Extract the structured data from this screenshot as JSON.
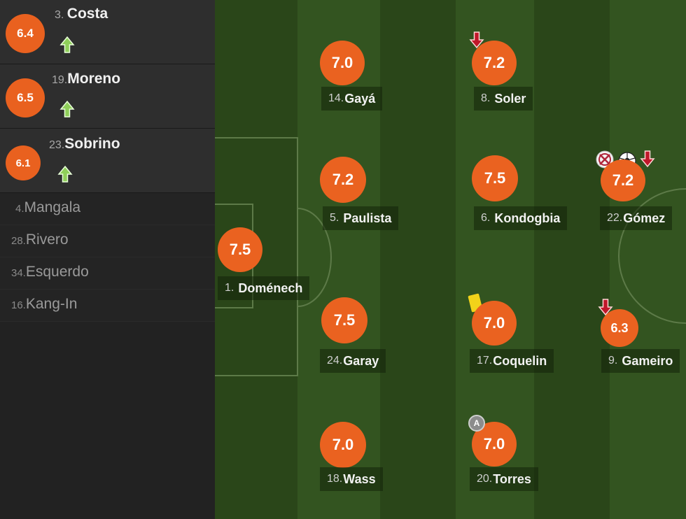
{
  "substitutes": [
    {
      "number": "3.",
      "name": "Costa",
      "rating": "6.4"
    },
    {
      "number": "19.",
      "name": "Moreno",
      "rating": "6.5"
    },
    {
      "number": "23.",
      "name": "Sobrino",
      "rating": "6.1"
    }
  ],
  "bench": [
    {
      "number": "4.",
      "name": "Mangala"
    },
    {
      "number": "28.",
      "name": "Rivero"
    },
    {
      "number": "34.",
      "name": "Esquerdo"
    },
    {
      "number": "16.",
      "name": "Kang-In"
    }
  ],
  "players": {
    "domenech": {
      "number": "1.",
      "name": "Doménech",
      "rating": "7.5"
    },
    "gaya": {
      "number": "14.",
      "name": "Gayá",
      "rating": "7.0"
    },
    "paulista": {
      "number": "5.",
      "name": "Paulista",
      "rating": "7.2"
    },
    "garay": {
      "number": "24.",
      "name": "Garay",
      "rating": "7.5"
    },
    "wass": {
      "number": "18.",
      "name": "Wass",
      "rating": "7.0"
    },
    "soler": {
      "number": "8.",
      "name": "Soler",
      "rating": "7.2"
    },
    "kondogbia": {
      "number": "6.",
      "name": "Kondogbia",
      "rating": "7.5"
    },
    "coquelin": {
      "number": "17.",
      "name": "Coquelin",
      "rating": "7.0"
    },
    "torres": {
      "number": "20.",
      "name": "Torres",
      "rating": "7.0"
    },
    "gomez": {
      "number": "22.",
      "name": "Gómez",
      "rating": "7.2"
    },
    "gameiro": {
      "number": "9.",
      "name": "Gameiro",
      "rating": "6.3"
    }
  },
  "captain_badge": "A",
  "colors": {
    "rating": "#ea6220",
    "sub_out": "#c0182a",
    "sub_in": "#8fcf5a",
    "yellow_card": "#f2d21a"
  }
}
